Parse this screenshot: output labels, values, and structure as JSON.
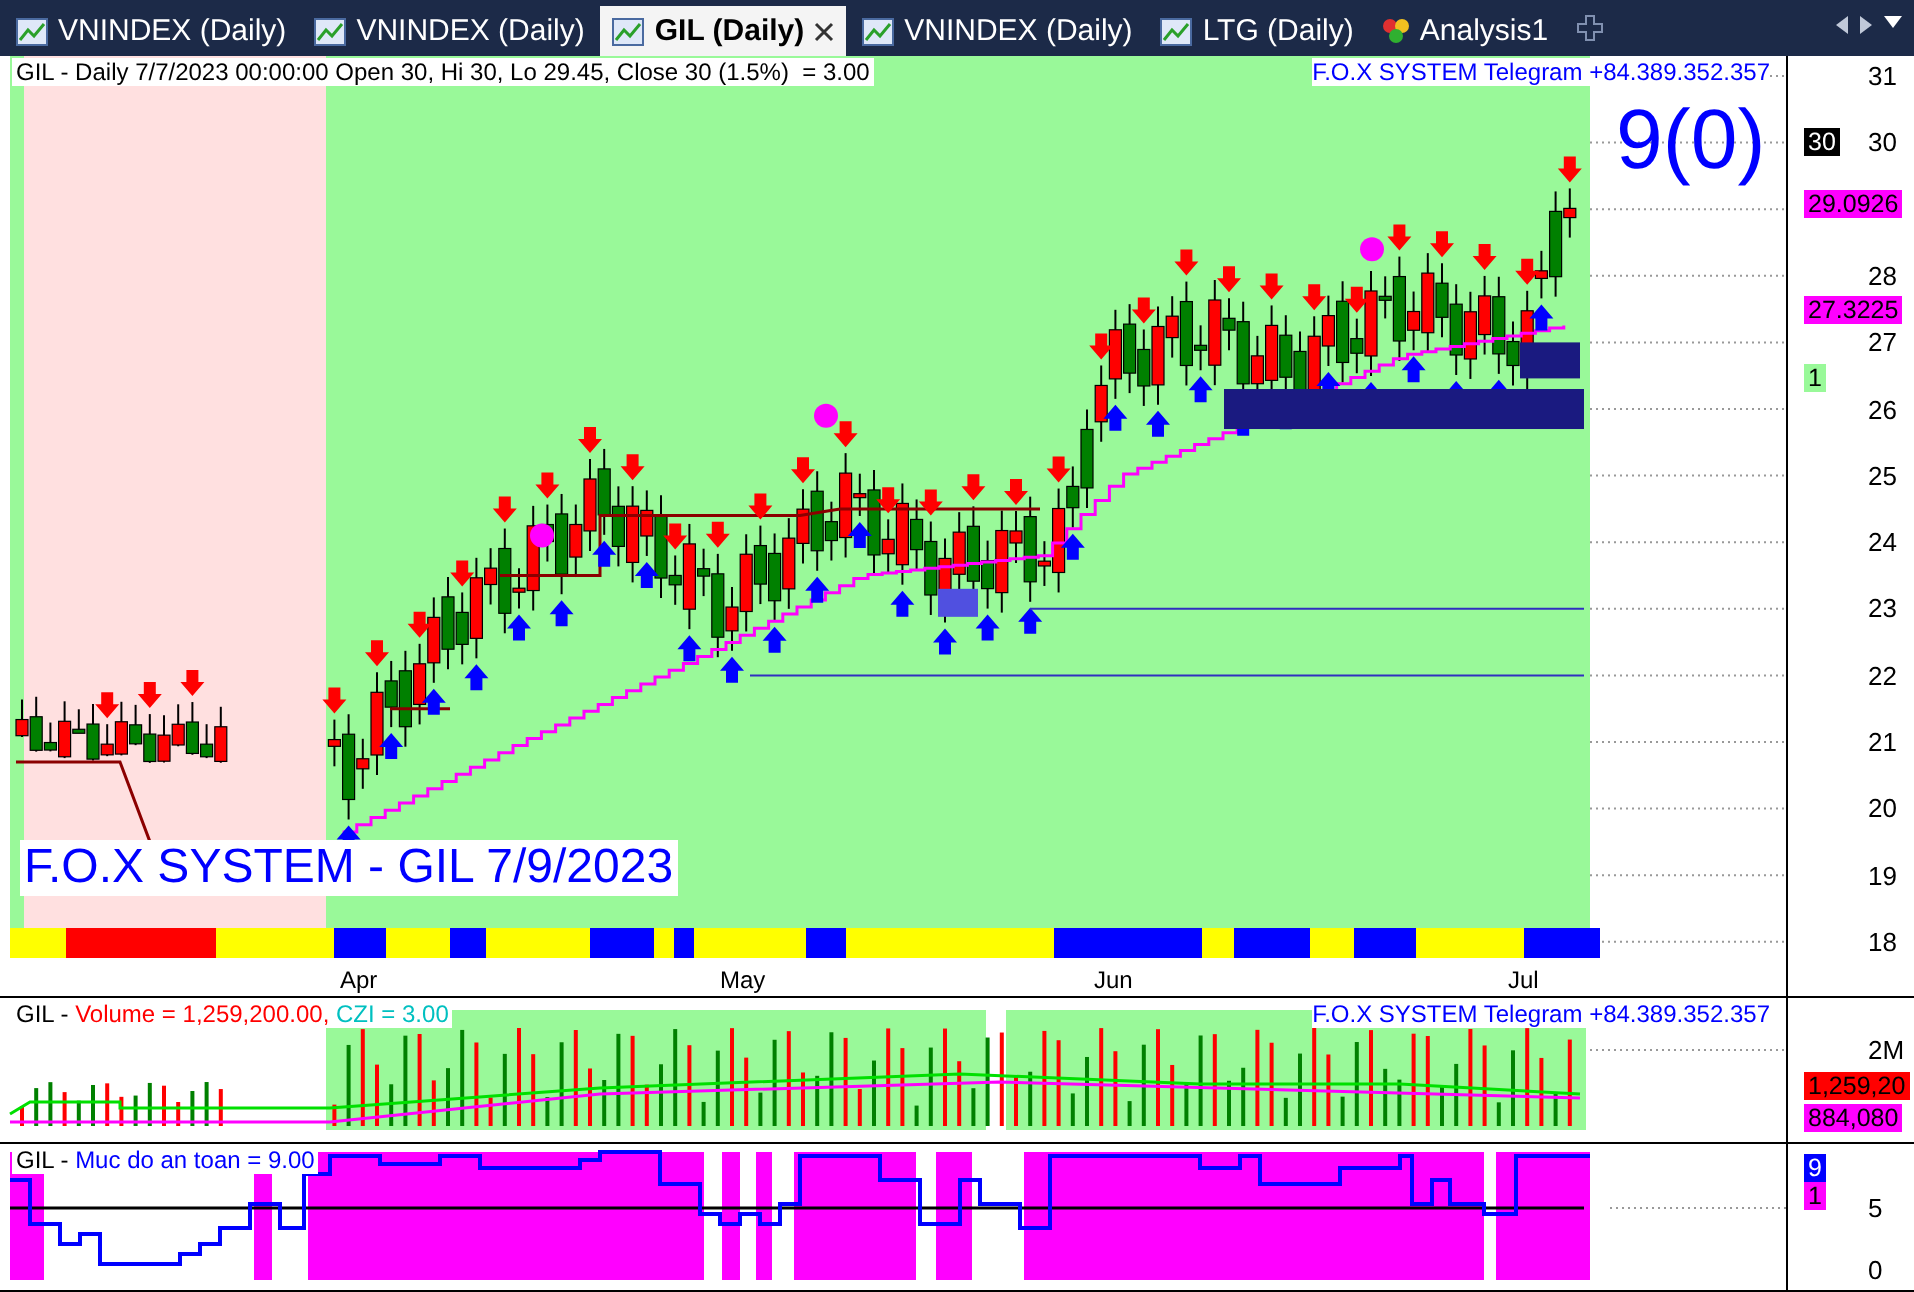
{
  "tabs": [
    {
      "label": "VNINDEX (Daily)",
      "kind": "chart",
      "selected": false
    },
    {
      "label": "VNINDEX (Daily)",
      "kind": "chart",
      "selected": false
    },
    {
      "label": "GIL (Daily)",
      "kind": "chart",
      "selected": true
    },
    {
      "label": "VNINDEX (Daily)",
      "kind": "chart",
      "selected": false
    },
    {
      "label": "LTG (Daily)",
      "kind": "chart",
      "selected": false
    },
    {
      "label": "Analysis1",
      "kind": "analysis",
      "selected": false
    }
  ],
  "price_panel": {
    "header": "GIL - Daily 7/7/2023 00:00:00 Open 30, Hi 30, Lo 29.45, Close 30 (1.5%)  = 3.00",
    "telegram": "F.O.X SYSTEM Telegram +84.389.352.357",
    "signal": "9(0)",
    "banner": "F.O.X SYSTEM - GIL 7/9/2023",
    "axis_labels": [
      "31",
      "30",
      "28",
      "27",
      "26",
      "25",
      "24",
      "23",
      "22",
      "21",
      "20",
      "19",
      "18"
    ],
    "price_tags": [
      {
        "text": "30",
        "color": "#000000"
      },
      {
        "text": "29.0926",
        "color": "#ff00ff"
      },
      {
        "text": "27.3225",
        "color": "#ff00ff"
      },
      {
        "text": "1",
        "color": "#99f999"
      }
    ],
    "months": [
      "Apr",
      "May",
      "Jun",
      "Jul"
    ]
  },
  "volume_panel": {
    "header": [
      {
        "text": "GIL - ",
        "color": "#000000"
      },
      {
        "text": "Volume = 1,259,200.00, ",
        "color": "#ff0000"
      },
      {
        "text": "CZI = 3.00",
        "color": "#00c0c0"
      }
    ],
    "telegram": "F.O.X SYSTEM Telegram +84.389.352.357",
    "axis_labels": [
      "2M"
    ],
    "tags": [
      {
        "text": "1,259,20",
        "color": "#ff0000"
      },
      {
        "text": "884,080",
        "color": "#ff00ff"
      }
    ]
  },
  "safety_panel": {
    "header": [
      {
        "text": "GIL - ",
        "color": "#000000"
      },
      {
        "text": "Muc do an toan = 9.00",
        "color": "#0000ff"
      }
    ],
    "axis_labels": [
      "5",
      "0"
    ],
    "tags": [
      {
        "text": "9",
        "color": "#0000ff"
      },
      {
        "text": "1",
        "color": "#ff00ff"
      }
    ]
  }
}
